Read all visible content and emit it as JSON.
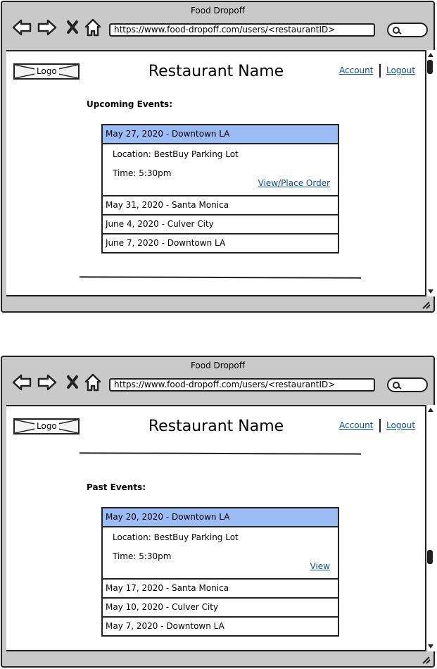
{
  "browser": {
    "title": "Food Dropoff",
    "url": "https://www.food-dropoff.com/users/<restaurantID>"
  },
  "header": {
    "logo": "Logo",
    "restaurant_name": "Restaurant Name",
    "account_link": "Account",
    "logout_link": "Logout"
  },
  "upcoming": {
    "title": "Upcoming Events:",
    "expanded": {
      "label": "May 27, 2020 - Downtown LA",
      "location": "Location: BestBuy Parking Lot",
      "time": "Time: 5:30pm",
      "action": "View/Place Order"
    },
    "events": [
      "May 31, 2020 - Santa Monica",
      "June 4, 2020 - Culver City",
      "June 7, 2020 - Downtown LA"
    ]
  },
  "past": {
    "title": "Past Events:",
    "expanded": {
      "label": "May 20, 2020 - Downtown LA",
      "location": "Location: BestBuy Parking Lot",
      "time": "Time: 5:30pm",
      "action": "View"
    },
    "events": [
      "May 17, 2020 - Santa Monica",
      "May 10, 2020 - Culver City",
      "May 7, 2020 - Downtown LA"
    ]
  },
  "colors": {
    "selected_row": "#9bbcf5",
    "link": "#0b4fa3",
    "chrome": "#c9c9c9"
  }
}
